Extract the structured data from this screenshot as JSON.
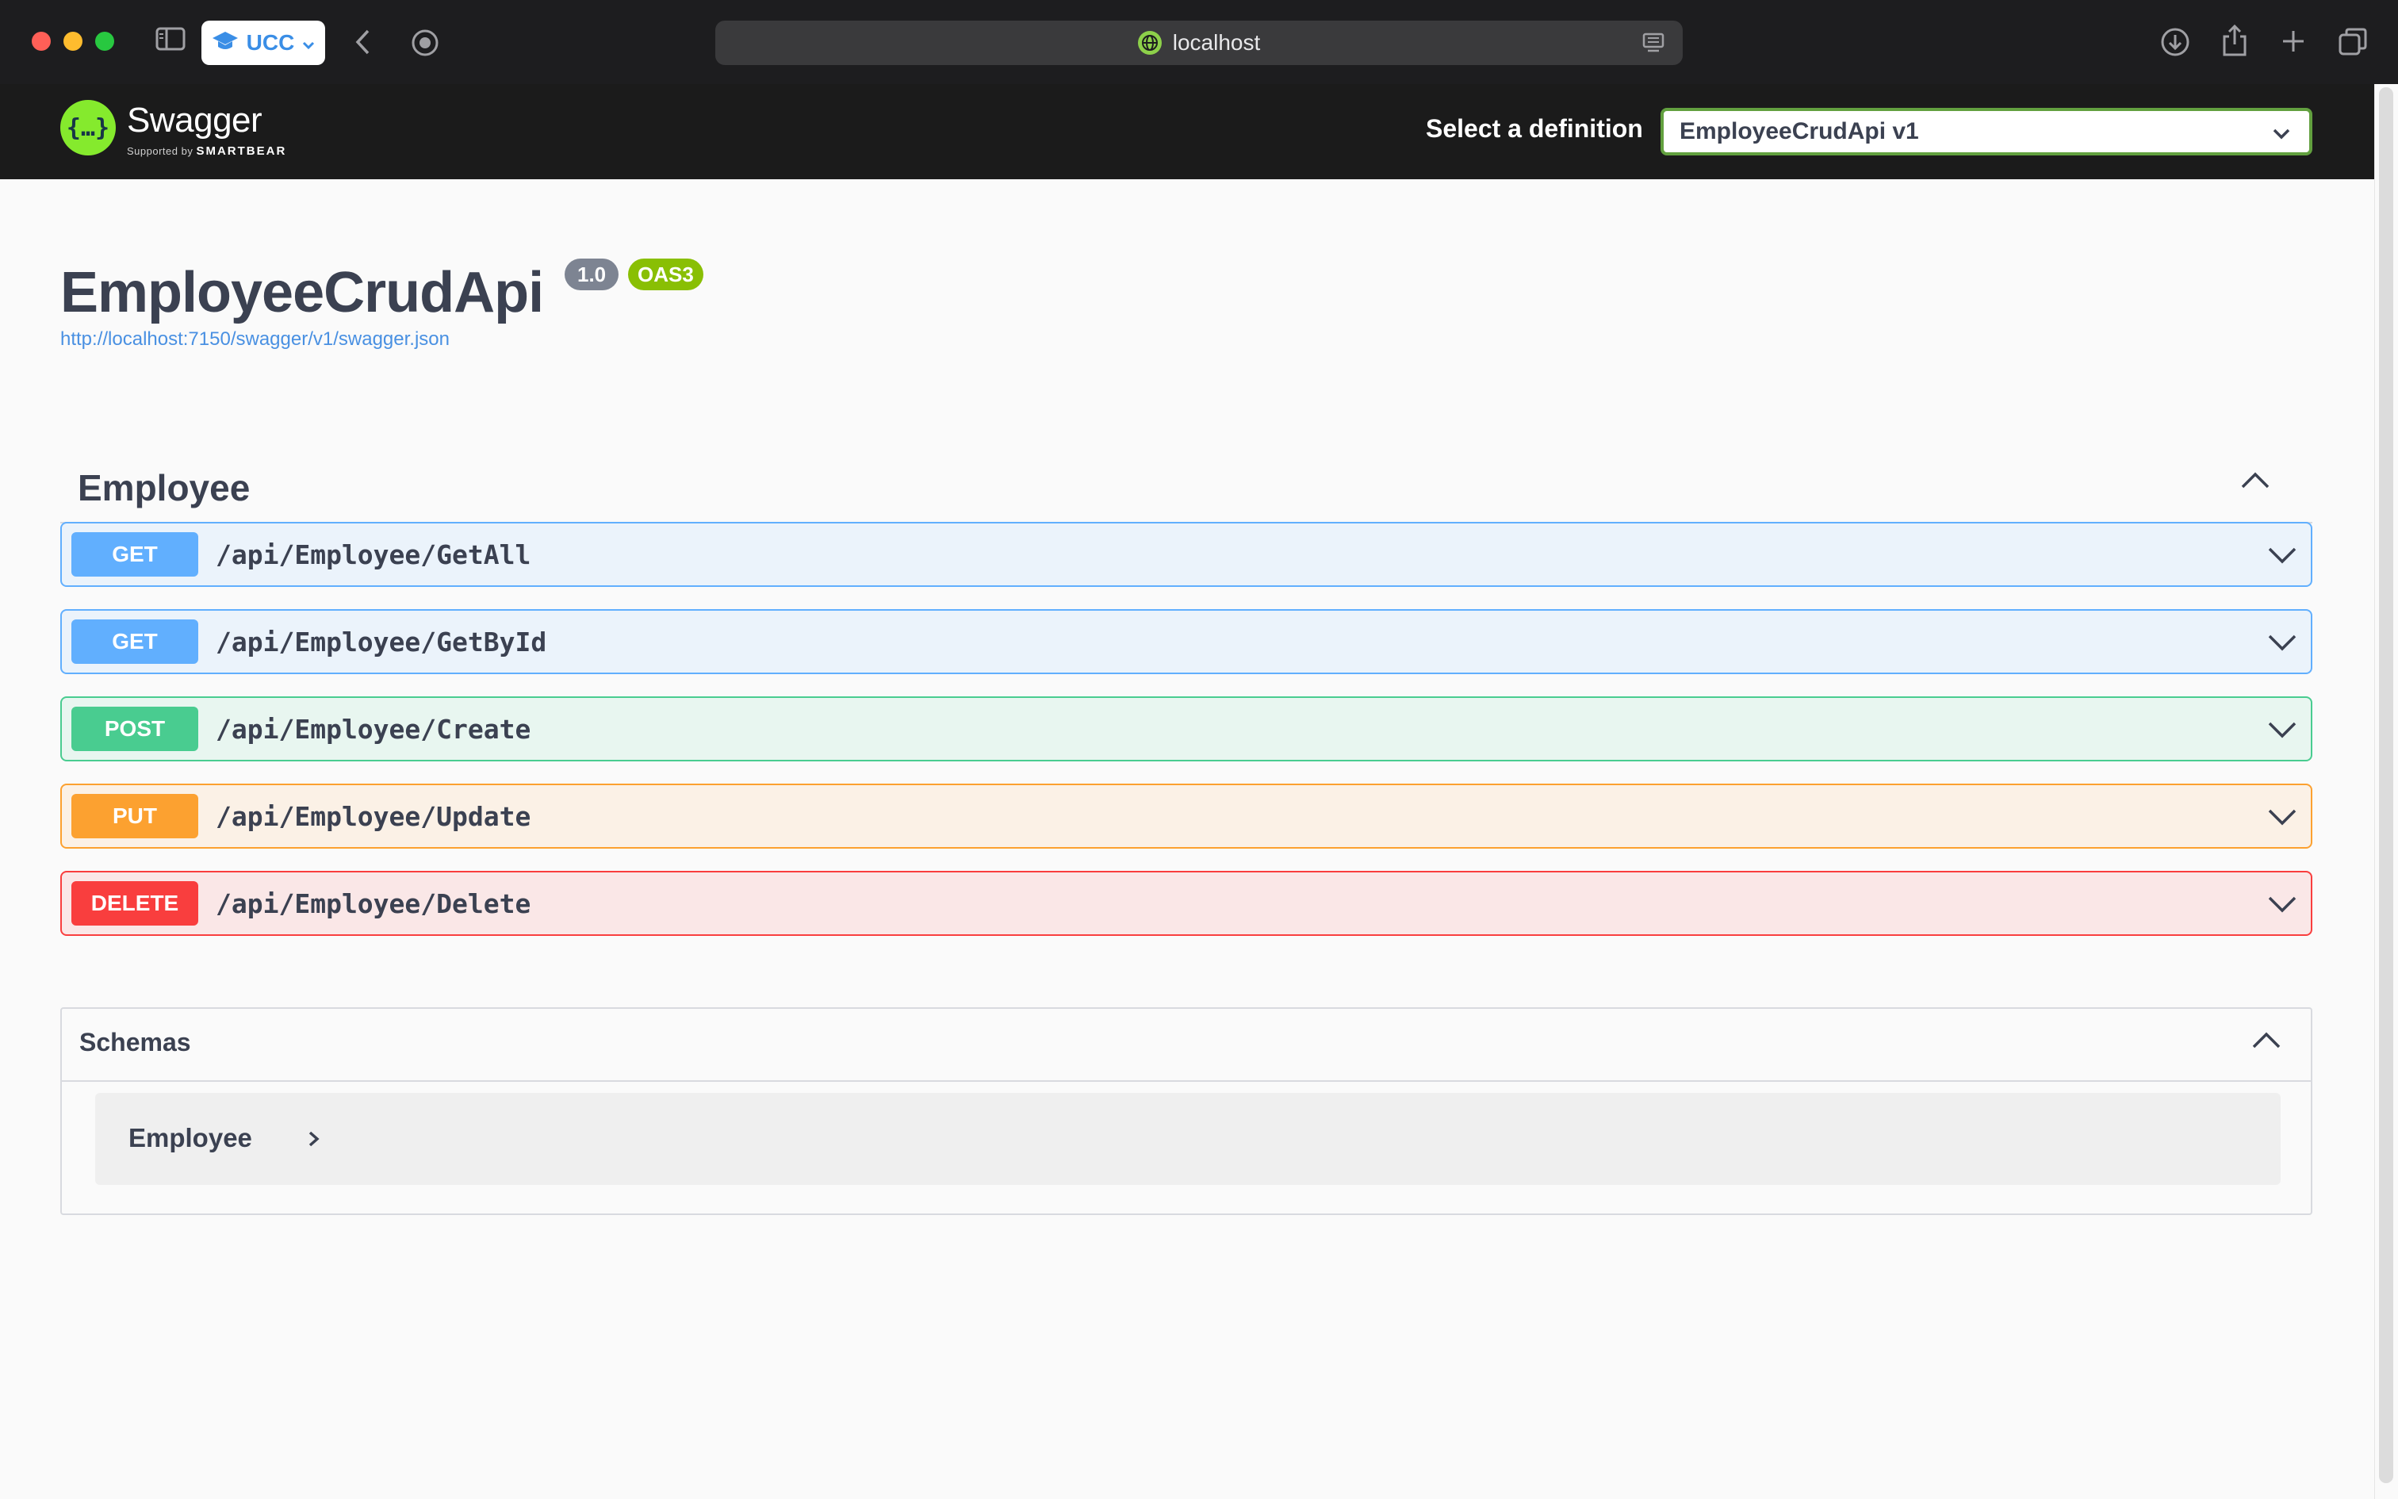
{
  "browser": {
    "tab_group_label": "UCC",
    "address": "localhost"
  },
  "topbar": {
    "logo_title": "Swagger",
    "logo_supported_by": "Supported by",
    "logo_brand": "SMARTBEAR",
    "definition_label": "Select a definition",
    "definition_selected": "EmployeeCrudApi v1"
  },
  "info": {
    "title": "EmployeeCrudApi",
    "version": "1.0",
    "oas_badge": "OAS3",
    "spec_url": "http://localhost:7150/swagger/v1/swagger.json"
  },
  "tag": {
    "name": "Employee",
    "operations": [
      {
        "method": "GET",
        "path": "/api/Employee/GetAll"
      },
      {
        "method": "GET",
        "path": "/api/Employee/GetById"
      },
      {
        "method": "POST",
        "path": "/api/Employee/Create"
      },
      {
        "method": "PUT",
        "path": "/api/Employee/Update"
      },
      {
        "method": "DELETE",
        "path": "/api/Employee/Delete"
      }
    ]
  },
  "schemas": {
    "title": "Schemas",
    "models": [
      {
        "name": "Employee"
      }
    ]
  },
  "colors": {
    "get": "#61affe",
    "post": "#49cc90",
    "put": "#fca130",
    "delete": "#f93e3e",
    "swagger_green": "#85ea2d"
  }
}
